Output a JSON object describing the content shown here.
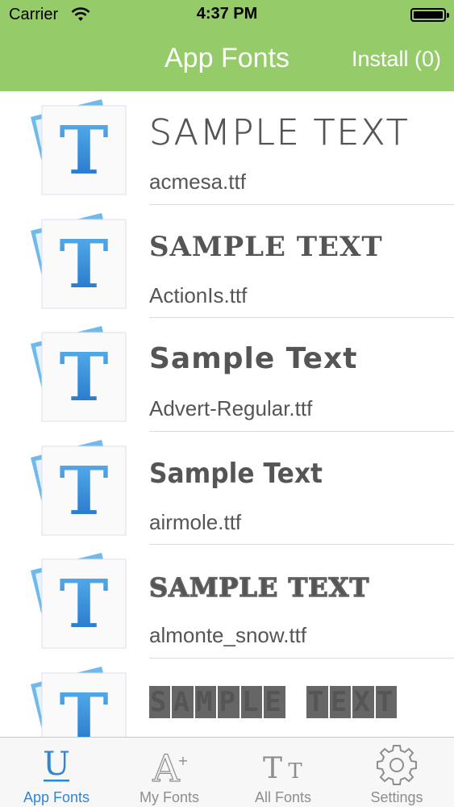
{
  "status": {
    "carrier": "Carrier",
    "time": "4:37 PM"
  },
  "nav": {
    "title": "App Fonts",
    "install_label": "Install (0)"
  },
  "fonts": [
    {
      "sample": "SAMPLE TEXT",
      "filename": "acmesa.ttf"
    },
    {
      "sample": "SAMPLE TEXT",
      "filename": "ActionIs.ttf"
    },
    {
      "sample": "Sample Text",
      "filename": "Advert-Regular.ttf"
    },
    {
      "sample": "Sample Text",
      "filename": "airmole.ttf"
    },
    {
      "sample": "SAMPLE TEXT",
      "filename": "almonte_snow.ttf"
    },
    {
      "sample": "SAMPLE TEXT",
      "filename": ""
    }
  ],
  "tabs": [
    {
      "label": "App Fonts",
      "icon": "u-letter-icon",
      "active": true
    },
    {
      "label": "My Fonts",
      "icon": "a-plus-icon",
      "active": false
    },
    {
      "label": "All Fonts",
      "icon": "tt-letters-icon",
      "active": false
    },
    {
      "label": "Settings",
      "icon": "gear-icon",
      "active": false
    }
  ],
  "colors": {
    "header": "#96cb6a",
    "tab_active": "#2f86d4",
    "tab_inactive": "#8e8e8e"
  }
}
